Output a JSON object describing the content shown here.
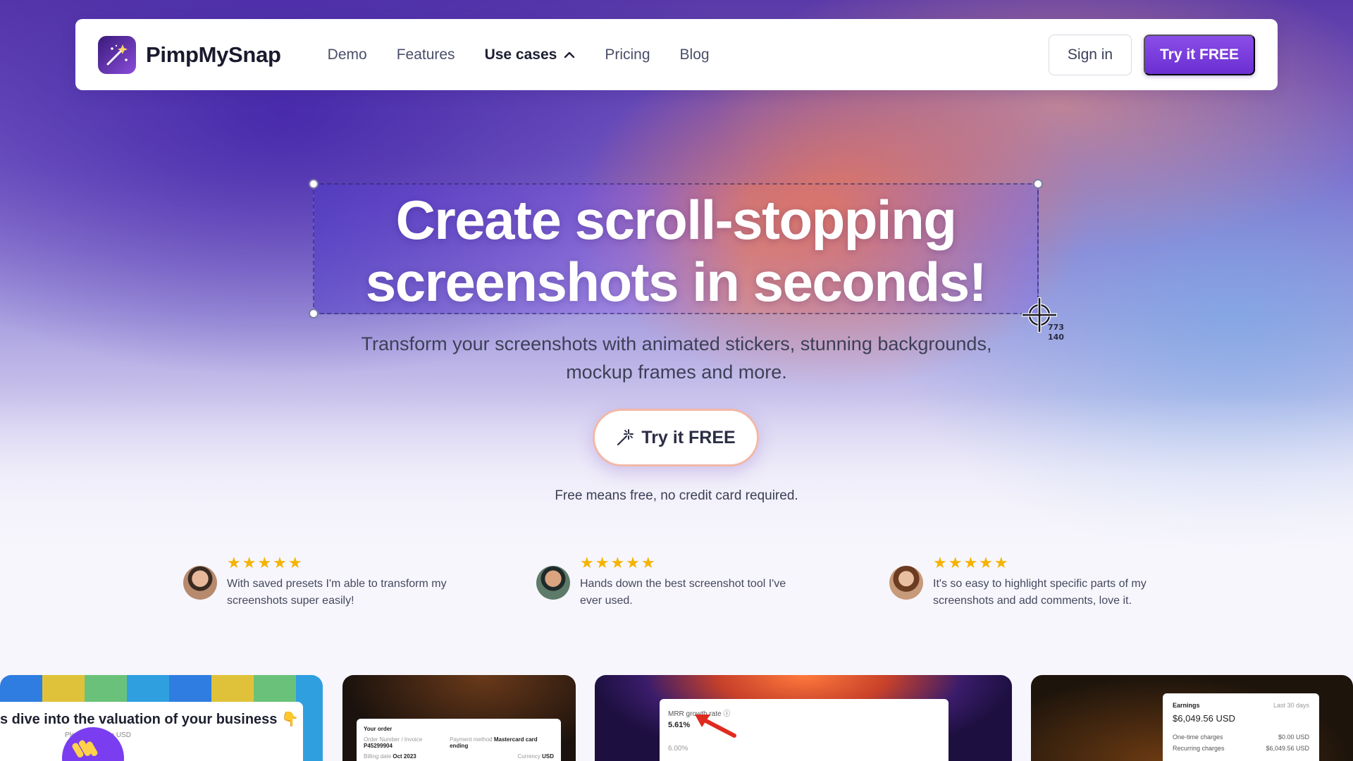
{
  "brand": {
    "name": "PimpMySnap",
    "logo_icon": "magic-wand-icon"
  },
  "nav": {
    "items": [
      {
        "label": "Demo"
      },
      {
        "label": "Features"
      },
      {
        "label": "Use cases",
        "expanded": true
      },
      {
        "label": "Pricing"
      },
      {
        "label": "Blog"
      }
    ],
    "signin_label": "Sign in",
    "try_label": "Try it FREE"
  },
  "hero": {
    "headline_line1": "Create scroll-stopping",
    "headline_line2": "screenshots in seconds!",
    "selection_width": "773",
    "selection_height": "140",
    "subtitle_line1": "Transform your screenshots with animated stickers, stunning backgrounds,",
    "subtitle_line2": "mockup frames and more.",
    "cta_label": "Try it FREE",
    "cta_icon": "magic-wand-icon",
    "cta_note": "Free means free, no credit card required."
  },
  "testimonials": [
    {
      "stars": "★★★★★",
      "rating": 5,
      "line1": "With saved presets I'm able to transform my",
      "line2": "screenshots super easily!"
    },
    {
      "stars": "★★★★★",
      "rating": 5,
      "line1": "Hands down the best screenshot tool I've",
      "line2": "ever used."
    },
    {
      "stars": "★★★★★",
      "rating": 5,
      "line1": "It's so easy to highlight specific parts of my",
      "line2": "screenshots and add comments, love it."
    }
  ],
  "previews": {
    "card1": {
      "title": "s dive into the valuation of your business 👇",
      "sub": "Ple...ures are in USD"
    },
    "card2": {
      "heading": "Your order",
      "order_label": "Order Number / Invoice",
      "order_value": "P45299904",
      "payment_label": "Payment method",
      "payment_value": "Mastercard card ending",
      "billing_label": "Billing date",
      "billing_value": "Oct 2023",
      "currency_label": "Currency",
      "currency_value": "USD"
    },
    "card3": {
      "metric_label": "MRR growth rate",
      "metric_value": "5.61%",
      "axis_tick": "6.00%"
    },
    "card4": {
      "label": "Earnings",
      "period": "Last 30 days",
      "value": "$6,049.56 USD",
      "row1_label": "One-time charges",
      "row1_value": "$0.00 USD",
      "row2_label": "Recurring charges",
      "row2_value": "$6,049.56 USD"
    }
  },
  "colors": {
    "accent": "#7c3aed",
    "star": "#f5b301",
    "text_dark": "#1d1f33"
  }
}
